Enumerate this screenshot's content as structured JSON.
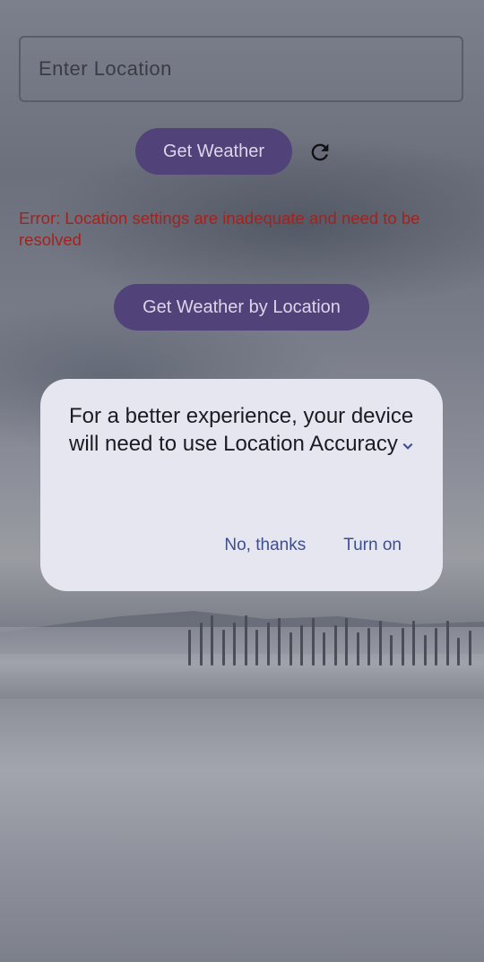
{
  "input": {
    "placeholder": "Enter Location"
  },
  "buttons": {
    "get_weather": "Get Weather",
    "get_weather_by_location": "Get Weather by Location"
  },
  "error_text": "Error: Location settings are inadequate and need to be resolved",
  "dialog": {
    "message": "For a better experience, your device will need to use Location Accuracy",
    "no_label": "No, thanks",
    "yes_label": "Turn on"
  },
  "icons": {
    "refresh": "refresh-icon",
    "expand": "chevron-down-icon"
  },
  "colors": {
    "primary_button": "#51427a",
    "error": "#a3221e",
    "dialog_bg": "#e6e6f1",
    "dialog_action": "#3e4e93"
  }
}
